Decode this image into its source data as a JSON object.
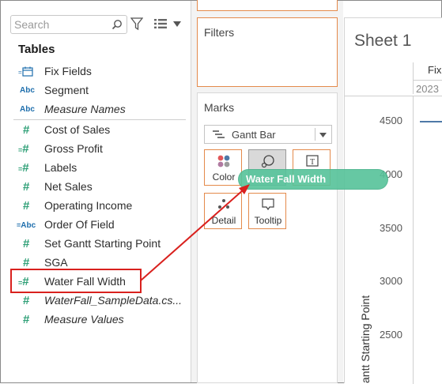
{
  "data_pane": {
    "search_placeholder": "Search",
    "tables_title": "Tables",
    "dimensions": [
      {
        "icon": "date-icon",
        "name": "Fix Fields",
        "italic": false
      },
      {
        "icon": "abc-icon",
        "name": "Segment",
        "italic": false
      },
      {
        "icon": "abc-icon",
        "name": "Measure Names",
        "italic": true
      }
    ],
    "measures": [
      {
        "icon": "measure-icon",
        "name": "Cost of Sales",
        "italic": false
      },
      {
        "icon": "calc-measure-icon",
        "name": "Gross Profit",
        "italic": false
      },
      {
        "icon": "calc-measure-icon",
        "name": "Labels",
        "italic": false
      },
      {
        "icon": "measure-icon",
        "name": "Net Sales",
        "italic": false
      },
      {
        "icon": "measure-icon",
        "name": "Operating Income",
        "italic": false
      },
      {
        "icon": "calc-abc-icon",
        "name": "Order Of Field",
        "italic": false
      },
      {
        "icon": "measure-icon",
        "name": "Set Gantt Starting Point",
        "italic": false
      },
      {
        "icon": "measure-icon",
        "name": "SGA",
        "italic": false
      },
      {
        "icon": "calc-measure-icon",
        "name": "Water Fall Width",
        "italic": false
      },
      {
        "icon": "measure-icon",
        "name": "WaterFall_SampleData.cs...",
        "italic": true
      },
      {
        "icon": "measure-icon",
        "name": "Measure Values",
        "italic": true
      }
    ],
    "highlighted_field": "Water Fall Width"
  },
  "cards": {
    "filters_title": "Filters",
    "marks_title": "Marks",
    "mark_type": "Gantt Bar",
    "buttons": {
      "color": "Color",
      "size": "",
      "label": "",
      "detail": "Detail",
      "tooltip": "Tooltip"
    }
  },
  "drag_pill": {
    "label": "Water Fall Width",
    "color": "#56c39a"
  },
  "sheet": {
    "title": "Sheet 1",
    "column_header": "Fix",
    "column_year": "2023",
    "y_axis_label": "antt Starting Point",
    "y_ticks": [
      "4500",
      "4000",
      "3500",
      "3000",
      "2500"
    ]
  },
  "colors": {
    "highlight": "#d9211e",
    "card_border": "#e48a4b",
    "measure_green": "#2e9f76",
    "dimension_blue": "#1f6fad",
    "gantt_bar": "#4e79a7"
  }
}
